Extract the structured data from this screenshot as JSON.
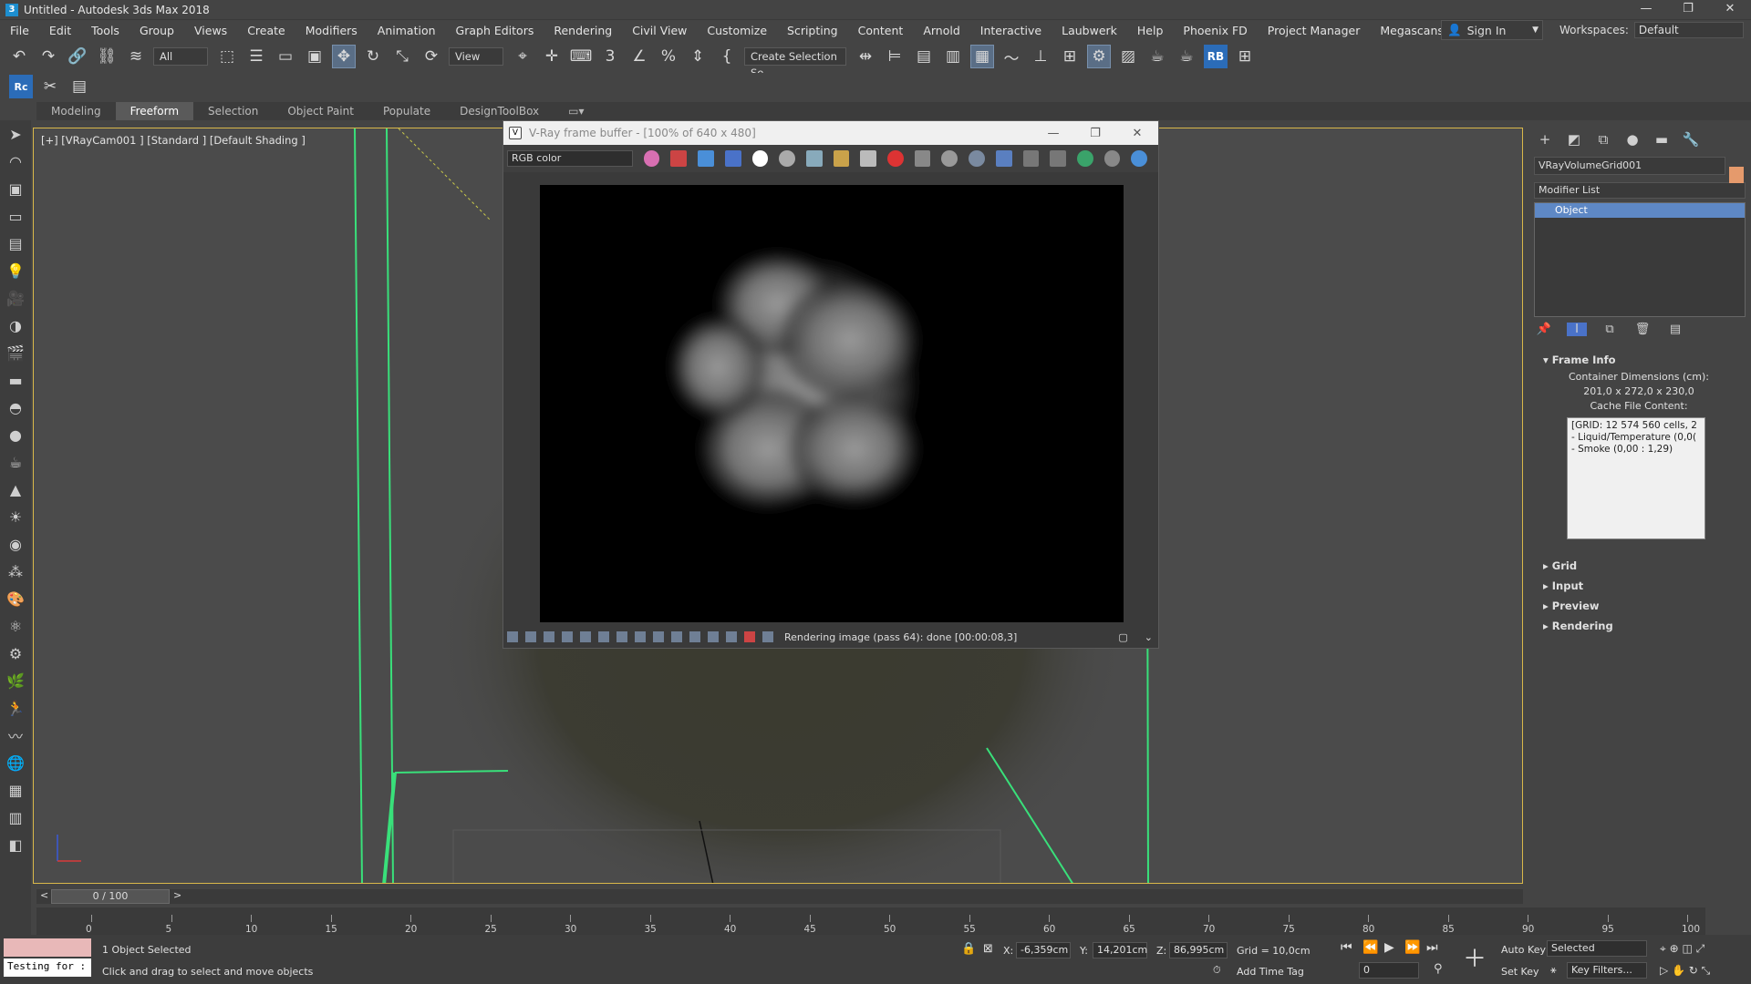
{
  "window": {
    "title": "Untitled - Autodesk 3ds Max 2018",
    "minimize": "—",
    "maximize": "❐",
    "close": "✕"
  },
  "menu": {
    "items": [
      "File",
      "Edit",
      "Tools",
      "Group",
      "Views",
      "Create",
      "Modifiers",
      "Animation",
      "Graph Editors",
      "Rendering",
      "Civil View",
      "Customize",
      "Scripting",
      "Content",
      "Arnold",
      "Interactive",
      "Laubwerk",
      "Help",
      "Phoenix FD",
      "Project Manager",
      "Megascans"
    ],
    "sign_in": "Sign In",
    "workspaces_label": "Workspaces:",
    "workspaces_value": "Default"
  },
  "toolbar": {
    "filter_value": "All",
    "ref_coord_value": "View",
    "selection_set_value": "Create Selection Se"
  },
  "ribbon": {
    "tabs": [
      "Modeling",
      "Freeform",
      "Selection",
      "Object Paint",
      "Populate",
      "DesignToolBox"
    ],
    "active_tab": "Freeform"
  },
  "viewport": {
    "label": "[+] [VRayCam001 ] [Standard ] [Default Shading ]"
  },
  "vfb": {
    "title": "V-Ray frame buffer - [100% of 640 x 480]",
    "channel_value": "RGB color",
    "status": "Rendering image (pass 64): done [00:00:08,3]"
  },
  "command_panel": {
    "object_name": "VRayVolumeGrid001",
    "modifier_list": "Modifier List",
    "stack_item": "Object",
    "frame_info_title": "Frame Info",
    "container_dims_label": "Container Dimensions (cm):",
    "container_dims_value": "201,0 x 272,0 x 230,0",
    "cache_label": "Cache File Content:",
    "cache_lines": [
      "[GRID: 12 574 560 cells, 2",
      "- Liquid/Temperature (0,0(",
      "- Smoke (0,00 : 1,29)"
    ],
    "rollouts": [
      "Grid",
      "Input",
      "Preview",
      "Rendering"
    ]
  },
  "timeline": {
    "frame_display": "0 / 100",
    "ticks": [
      "0",
      "5",
      "10",
      "15",
      "20",
      "25",
      "30",
      "35",
      "40",
      "45",
      "50",
      "55",
      "60",
      "65",
      "70",
      "75",
      "80",
      "85",
      "90",
      "95",
      "100"
    ]
  },
  "status": {
    "selected": "1 Object Selected",
    "prompt": "Click and drag to select and move objects",
    "maxscript": "Testing for :",
    "x_label": "X:",
    "x_value": "-6,359cm",
    "y_label": "Y:",
    "y_value": "14,201cm",
    "z_label": "Z:",
    "z_value": "86,995cm",
    "grid": "Grid = 10,0cm",
    "add_time_tag": "Add Time Tag",
    "auto_key": "Auto Key",
    "set_key": "Set Key",
    "selected_dropdown": "Selected",
    "key_filters": "Key Filters...",
    "frame_field": "0"
  }
}
